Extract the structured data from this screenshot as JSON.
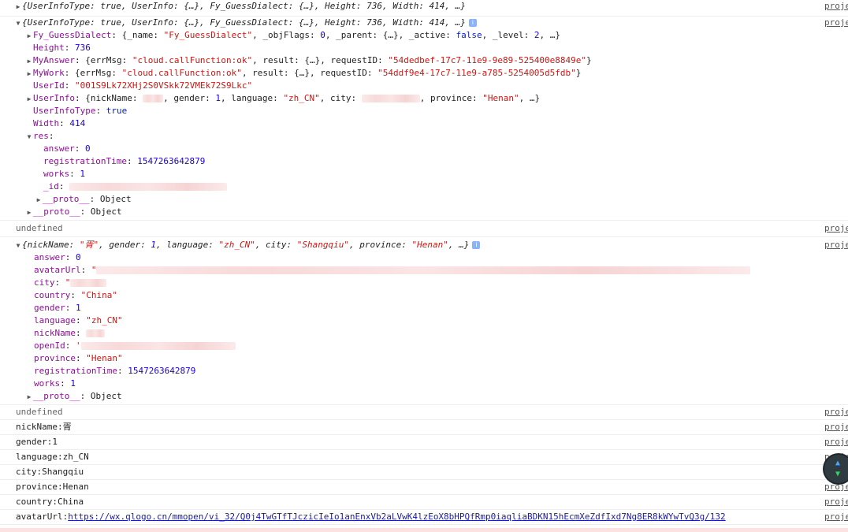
{
  "source_link": "proje",
  "undefined_label": "undefined",
  "row1": {
    "summary": "{UserInfoType: true, UserInfo: {…}, Fy_GuessDialect: {…}, Height: 736, Width: 414, …}"
  },
  "row2": {
    "summary": "{UserInfoType: true, UserInfo: {…}, Fy_GuessDialect: {…}, Height: 736, Width: 414, …}",
    "info_glyph": "i",
    "fy_key": "Fy_GuessDialect",
    "fy_a": "{_name: ",
    "fy_name": "\"Fy_GuessDialect\"",
    "fy_b": ", _objFlags: ",
    "fy_flags": "0",
    "fy_c": ", _parent: {…}, _active: ",
    "fy_active": "false",
    "fy_d": ", _level: ",
    "fy_level": "2",
    "fy_e": ", …}",
    "height_key": "Height",
    "height_val": "736",
    "myanswer_key": "MyAnswer",
    "myanswer_a": "{errMsg: ",
    "myanswer_msg": "\"cloud.callFunction:ok\"",
    "myanswer_b": ", result: {…}, requestID: ",
    "myanswer_req": "\"54dedbef-17c7-11e9-9e89-525400e8849e\"",
    "myanswer_c": "}",
    "mywork_key": "MyWork",
    "mywork_a": "{errMsg: ",
    "mywork_msg": "\"cloud.callFunction:ok\"",
    "mywork_b": ", result: {…}, requestID: ",
    "mywork_req": "\"54ddf9e4-17c7-11e9-a785-5254005d5fdb\"",
    "mywork_c": "}",
    "userid_key": "UserId",
    "userid_val": "\"001S9Lk72XHj2S0VSkk72VMEk72S9Lkc\"",
    "userinfo_key": "UserInfo",
    "userinfo_a": "{nickName: ",
    "userinfo_b": ", gender: ",
    "userinfo_gender": "1",
    "userinfo_c": ", language: ",
    "userinfo_lang": "\"zh_CN\"",
    "userinfo_d": ", city: ",
    "userinfo_e": ", province: ",
    "userinfo_prov": "\"Henan\"",
    "userinfo_f": ", …}",
    "uit_key": "UserInfoType",
    "uit_val": "true",
    "width_key": "Width",
    "width_val": "414",
    "res_key": "res",
    "res_answer_key": "answer",
    "res_answer_val": "0",
    "res_reg_key": "registrationTime",
    "res_reg_val": "1547263642879",
    "res_works_key": "works",
    "res_works_val": "1",
    "res_id_key": "_id",
    "proto_key": "__proto__",
    "proto_val": "Object"
  },
  "row3": {
    "summary_a": "{nickName: ",
    "summary_nick": "\"胥\"",
    "summary_b": ", gender: ",
    "summary_gender": "1",
    "summary_c": ", language: ",
    "summary_lang": "\"zh_CN\"",
    "summary_d": ", city: ",
    "summary_city": "\"Shangqiu\"",
    "summary_e": ", province: ",
    "summary_prov": "\"Henan\"",
    "summary_f": ", …}",
    "info_glyph": "i",
    "answer_key": "answer",
    "answer_val": "0",
    "avatar_key": "avatarUrl",
    "avatar_val": "\"",
    "city_key": "city",
    "city_val": "\"",
    "country_key": "country",
    "country_val": "\"China\"",
    "gender_key": "gender",
    "gender_val": "1",
    "language_key": "language",
    "language_val": "\"zh_CN\"",
    "nick_key": "nickName",
    "openid_key": "openId",
    "openid_val": "'",
    "province_key": "province",
    "province_val": "\"Henan\"",
    "reg_key": "registrationTime",
    "reg_val": "1547263642879",
    "works_key": "works",
    "works_val": "1",
    "proto_key": "__proto__",
    "proto_val": "Object"
  },
  "plain_rows": [
    {
      "text": "nickName:胥"
    },
    {
      "text": "gender:1"
    },
    {
      "text": "language:zh_CN"
    },
    {
      "text": "city:Shangqiu"
    },
    {
      "text": "province:Henan"
    },
    {
      "text": "country:China"
    }
  ],
  "avatar_row": {
    "label": "avatarUrl:",
    "url": "https://wx.qlogo.cn/mmopen/vi_32/Q0j4TwGTfTJczicIeIo1anEnxVb2aLVwK4lzEoX8bHPQfRmp0iaqliaBDKN15hEcmXeZdfIxd7Ng8ER8kWYwTvQ3g/132"
  },
  "icons": {
    "expanded": "expanded-triangle-icon",
    "collapsed": "collapsed-triangle-icon",
    "scroll": "scroll-arrows-icon"
  }
}
